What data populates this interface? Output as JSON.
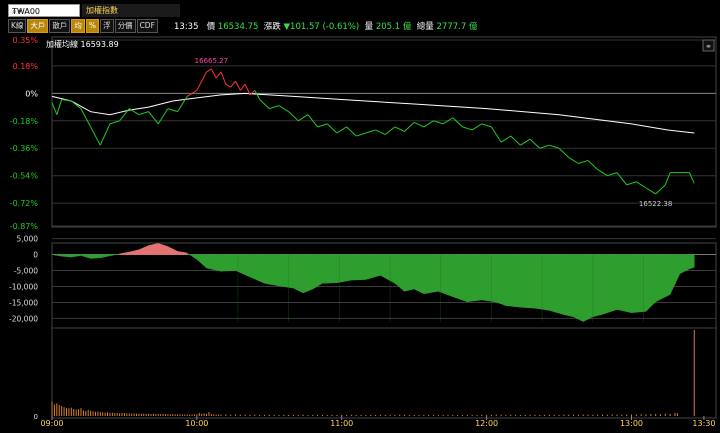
{
  "symbol": {
    "code": "TWA00",
    "tools": "⌕✦"
  },
  "index_name": "加權指數",
  "buttons": [
    {
      "label": "K線",
      "active": false
    },
    {
      "label": "大戶",
      "active": true
    },
    {
      "label": "散戶",
      "active": false
    },
    {
      "label": "均",
      "active": true
    },
    {
      "label": "%",
      "active": true
    },
    {
      "label": "浮",
      "active": false
    },
    {
      "label": "分價",
      "active": false
    },
    {
      "label": "CDF",
      "active": false
    }
  ],
  "quote": {
    "time": "13:35",
    "price_label": "價",
    "price": "16534.75",
    "change_label": "漲跌",
    "change": "▼101.57 (-0.61%)",
    "volume_label": "量",
    "volume": "205.1 億",
    "total_label": "總量",
    "total": "2777.7 億"
  },
  "colors": {
    "up": "#ff3333",
    "down": "#22cc22",
    "avg_line": "#ffffff",
    "volume": "#d9822b",
    "grid": "#555555",
    "fill_up": "#e57373",
    "fill_down": "#2e9e2e"
  },
  "chart_data": {
    "type": "line",
    "legend": "加權均線 16593.89",
    "reference_price": 16636.32,
    "price_ylabels": [
      "0.35%",
      "0.18%",
      "0%",
      "-0.18%",
      "-0.36%",
      "-0.54%",
      "-0.72%",
      "-0.87%"
    ],
    "price_ylabel_values": [
      0.35,
      0.18,
      0,
      -0.18,
      -0.36,
      -0.54,
      -0.72,
      -0.87
    ],
    "ylim_pct": [
      -0.87,
      0.35
    ],
    "x_ticks": [
      "09:00",
      "10:00",
      "11:00",
      "12:00",
      "13:00",
      "13:30"
    ],
    "x_tick_minutes": [
      0,
      60,
      120,
      180,
      240,
      270
    ],
    "xlim_minutes": [
      0,
      275
    ],
    "high_annotation": "16665.27",
    "low_annotation": "16522.38",
    "price_pct": [
      [
        0,
        -0.06
      ],
      [
        2,
        -0.14
      ],
      [
        4,
        -0.04
      ],
      [
        8,
        -0.05
      ],
      [
        12,
        -0.1
      ],
      [
        16,
        -0.22
      ],
      [
        20,
        -0.34
      ],
      [
        24,
        -0.2
      ],
      [
        28,
        -0.18
      ],
      [
        32,
        -0.1
      ],
      [
        36,
        -0.14
      ],
      [
        40,
        -0.12
      ],
      [
        44,
        -0.2
      ],
      [
        48,
        -0.1
      ],
      [
        52,
        -0.12
      ],
      [
        56,
        -0.02
      ],
      [
        60,
        0.02
      ],
      [
        62,
        0.08
      ],
      [
        64,
        0.14
      ],
      [
        66,
        0.16
      ],
      [
        68,
        0.1
      ],
      [
        70,
        0.14
      ],
      [
        72,
        0.06
      ],
      [
        74,
        0.04
      ],
      [
        76,
        0.08
      ],
      [
        78,
        0.02
      ],
      [
        80,
        0.06
      ],
      [
        82,
        -0.01
      ],
      [
        84,
        0.02
      ],
      [
        86,
        -0.04
      ],
      [
        90,
        -0.1
      ],
      [
        94,
        -0.08
      ],
      [
        98,
        -0.12
      ],
      [
        102,
        -0.18
      ],
      [
        106,
        -0.14
      ],
      [
        110,
        -0.22
      ],
      [
        114,
        -0.2
      ],
      [
        118,
        -0.26
      ],
      [
        122,
        -0.22
      ],
      [
        126,
        -0.28
      ],
      [
        130,
        -0.26
      ],
      [
        134,
        -0.24
      ],
      [
        138,
        -0.27
      ],
      [
        142,
        -0.22
      ],
      [
        146,
        -0.25
      ],
      [
        150,
        -0.19
      ],
      [
        154,
        -0.22
      ],
      [
        158,
        -0.18
      ],
      [
        162,
        -0.2
      ],
      [
        166,
        -0.16
      ],
      [
        170,
        -0.22
      ],
      [
        174,
        -0.24
      ],
      [
        178,
        -0.2
      ],
      [
        182,
        -0.22
      ],
      [
        186,
        -0.32
      ],
      [
        190,
        -0.28
      ],
      [
        194,
        -0.34
      ],
      [
        198,
        -0.3
      ],
      [
        202,
        -0.36
      ],
      [
        206,
        -0.34
      ],
      [
        210,
        -0.36
      ],
      [
        214,
        -0.42
      ],
      [
        218,
        -0.46
      ],
      [
        222,
        -0.44
      ],
      [
        226,
        -0.5
      ],
      [
        230,
        -0.54
      ],
      [
        234,
        -0.52
      ],
      [
        238,
        -0.6
      ],
      [
        242,
        -0.58
      ],
      [
        246,
        -0.62
      ],
      [
        250,
        -0.66
      ],
      [
        254,
        -0.6
      ],
      [
        256,
        -0.52
      ],
      [
        260,
        -0.52
      ],
      [
        264,
        -0.52
      ],
      [
        266,
        -0.59
      ]
    ],
    "avg_pct": [
      [
        0,
        -0.02
      ],
      [
        8,
        -0.05
      ],
      [
        16,
        -0.12
      ],
      [
        24,
        -0.14
      ],
      [
        32,
        -0.11
      ],
      [
        40,
        -0.09
      ],
      [
        50,
        -0.05
      ],
      [
        60,
        -0.03
      ],
      [
        70,
        -0.01
      ],
      [
        80,
        0.0
      ],
      [
        90,
        -0.01
      ],
      [
        100,
        -0.02
      ],
      [
        120,
        -0.04
      ],
      [
        150,
        -0.07
      ],
      [
        180,
        -0.1
      ],
      [
        210,
        -0.14
      ],
      [
        240,
        -0.2
      ],
      [
        255,
        -0.24
      ],
      [
        266,
        -0.26
      ]
    ],
    "diff_ylabels": [
      "5,000",
      "0",
      "-5,000",
      "-10,000",
      "-15,000",
      "-20,000"
    ],
    "diff_ylabel_values": [
      5000,
      0,
      -5000,
      -10000,
      -15000,
      -20000
    ],
    "ylim_diff": [
      -23000,
      5500
    ],
    "diff": [
      [
        0,
        0
      ],
      [
        4,
        -500
      ],
      [
        8,
        -800
      ],
      [
        12,
        -300
      ],
      [
        16,
        -1200
      ],
      [
        20,
        -1000
      ],
      [
        24,
        -400
      ],
      [
        28,
        200
      ],
      [
        32,
        800
      ],
      [
        36,
        1500
      ],
      [
        40,
        2800
      ],
      [
        44,
        3500
      ],
      [
        48,
        2500
      ],
      [
        52,
        1000
      ],
      [
        56,
        500
      ],
      [
        60,
        -1500
      ],
      [
        64,
        -4200
      ],
      [
        70,
        -5200
      ],
      [
        76,
        -5000
      ],
      [
        82,
        -7000
      ],
      [
        88,
        -9000
      ],
      [
        94,
        -9800
      ],
      [
        100,
        -10500
      ],
      [
        104,
        -12000
      ],
      [
        108,
        -10800
      ],
      [
        112,
        -9000
      ],
      [
        118,
        -8800
      ],
      [
        124,
        -8000
      ],
      [
        130,
        -7800
      ],
      [
        136,
        -6500
      ],
      [
        142,
        -9000
      ],
      [
        146,
        -11500
      ],
      [
        150,
        -10800
      ],
      [
        154,
        -12300
      ],
      [
        160,
        -11500
      ],
      [
        166,
        -13200
      ],
      [
        172,
        -14800
      ],
      [
        178,
        -14200
      ],
      [
        184,
        -14900
      ],
      [
        188,
        -16000
      ],
      [
        194,
        -16500
      ],
      [
        200,
        -16800
      ],
      [
        206,
        -17500
      ],
      [
        212,
        -18800
      ],
      [
        216,
        -19500
      ],
      [
        220,
        -21000
      ],
      [
        224,
        -19500
      ],
      [
        228,
        -18700
      ],
      [
        234,
        -17200
      ],
      [
        240,
        -18200
      ],
      [
        246,
        -17800
      ],
      [
        250,
        -14800
      ],
      [
        256,
        -12500
      ],
      [
        260,
        -6000
      ],
      [
        264,
        -4500
      ],
      [
        266,
        -4000
      ]
    ],
    "volume_max": 3300,
    "volume": [
      [
        0,
        540
      ],
      [
        1,
        440
      ],
      [
        2,
        480
      ],
      [
        3,
        420
      ],
      [
        4,
        380
      ],
      [
        5,
        340
      ],
      [
        6,
        300
      ],
      [
        7,
        290
      ],
      [
        8,
        320
      ],
      [
        9,
        270
      ],
      [
        10,
        250
      ],
      [
        11,
        260
      ],
      [
        12,
        300
      ],
      [
        13,
        210
      ],
      [
        14,
        190
      ],
      [
        15,
        240
      ],
      [
        16,
        200
      ],
      [
        17,
        180
      ],
      [
        18,
        160
      ],
      [
        19,
        170
      ],
      [
        20,
        150
      ],
      [
        21,
        140
      ],
      [
        22,
        130
      ],
      [
        23,
        140
      ],
      [
        24,
        120
      ],
      [
        25,
        130
      ],
      [
        26,
        120
      ],
      [
        27,
        110
      ],
      [
        28,
        100
      ],
      [
        29,
        120
      ],
      [
        30,
        110
      ],
      [
        31,
        100
      ],
      [
        32,
        95
      ],
      [
        33,
        90
      ],
      [
        34,
        100
      ],
      [
        35,
        90
      ],
      [
        36,
        85
      ],
      [
        37,
        80
      ],
      [
        38,
        90
      ],
      [
        39,
        80
      ],
      [
        40,
        85
      ],
      [
        41,
        75
      ],
      [
        42,
        80
      ],
      [
        43,
        70
      ],
      [
        44,
        75
      ],
      [
        45,
        70
      ],
      [
        46,
        80
      ],
      [
        47,
        70
      ],
      [
        48,
        65
      ],
      [
        49,
        60
      ],
      [
        50,
        70
      ],
      [
        51,
        60
      ],
      [
        52,
        65
      ],
      [
        53,
        60
      ],
      [
        54,
        55
      ],
      [
        55,
        60
      ],
      [
        56,
        55
      ],
      [
        57,
        50
      ],
      [
        58,
        60
      ],
      [
        59,
        65
      ],
      [
        60,
        70
      ],
      [
        61,
        120
      ],
      [
        62,
        90
      ],
      [
        63,
        100
      ],
      [
        64,
        80
      ],
      [
        65,
        150
      ],
      [
        66,
        70
      ],
      [
        67,
        60
      ],
      [
        68,
        55
      ],
      [
        69,
        60
      ],
      [
        70,
        50
      ],
      [
        72,
        60
      ],
      [
        74,
        50
      ],
      [
        76,
        55
      ],
      [
        78,
        45
      ],
      [
        80,
        50
      ],
      [
        82,
        45
      ],
      [
        84,
        50
      ],
      [
        86,
        40
      ],
      [
        88,
        45
      ],
      [
        90,
        50
      ],
      [
        92,
        45
      ],
      [
        94,
        40
      ],
      [
        96,
        45
      ],
      [
        98,
        40
      ],
      [
        100,
        45
      ],
      [
        102,
        40
      ],
      [
        104,
        50
      ],
      [
        106,
        40
      ],
      [
        108,
        45
      ],
      [
        110,
        40
      ],
      [
        112,
        45
      ],
      [
        114,
        40
      ],
      [
        116,
        45
      ],
      [
        118,
        40
      ],
      [
        120,
        45
      ],
      [
        122,
        40
      ],
      [
        124,
        50
      ],
      [
        126,
        40
      ],
      [
        128,
        45
      ],
      [
        130,
        40
      ],
      [
        132,
        45
      ],
      [
        134,
        40
      ],
      [
        136,
        45
      ],
      [
        138,
        40
      ],
      [
        140,
        45
      ],
      [
        142,
        40
      ],
      [
        144,
        50
      ],
      [
        146,
        45
      ],
      [
        148,
        40
      ],
      [
        150,
        45
      ],
      [
        152,
        40
      ],
      [
        154,
        45
      ],
      [
        156,
        40
      ],
      [
        158,
        45
      ],
      [
        160,
        40
      ],
      [
        162,
        45
      ],
      [
        164,
        40
      ],
      [
        166,
        45
      ],
      [
        168,
        40
      ],
      [
        170,
        45
      ],
      [
        172,
        40
      ],
      [
        174,
        45
      ],
      [
        176,
        40
      ],
      [
        178,
        50
      ],
      [
        180,
        45
      ],
      [
        182,
        40
      ],
      [
        184,
        50
      ],
      [
        186,
        45
      ],
      [
        188,
        40
      ],
      [
        190,
        50
      ],
      [
        192,
        45
      ],
      [
        194,
        40
      ],
      [
        196,
        45
      ],
      [
        198,
        50
      ],
      [
        200,
        45
      ],
      [
        202,
        40
      ],
      [
        204,
        45
      ],
      [
        206,
        50
      ],
      [
        208,
        45
      ],
      [
        210,
        40
      ],
      [
        212,
        50
      ],
      [
        214,
        45
      ],
      [
        216,
        50
      ],
      [
        218,
        45
      ],
      [
        220,
        55
      ],
      [
        222,
        50
      ],
      [
        224,
        45
      ],
      [
        226,
        50
      ],
      [
        228,
        55
      ],
      [
        230,
        50
      ],
      [
        232,
        60
      ],
      [
        234,
        55
      ],
      [
        236,
        50
      ],
      [
        238,
        55
      ],
      [
        240,
        60
      ],
      [
        242,
        55
      ],
      [
        244,
        65
      ],
      [
        246,
        60
      ],
      [
        248,
        70
      ],
      [
        250,
        80
      ],
      [
        252,
        70
      ],
      [
        254,
        90
      ],
      [
        256,
        80
      ],
      [
        258,
        120
      ],
      [
        259,
        110
      ],
      [
        266,
        3300
      ]
    ]
  }
}
